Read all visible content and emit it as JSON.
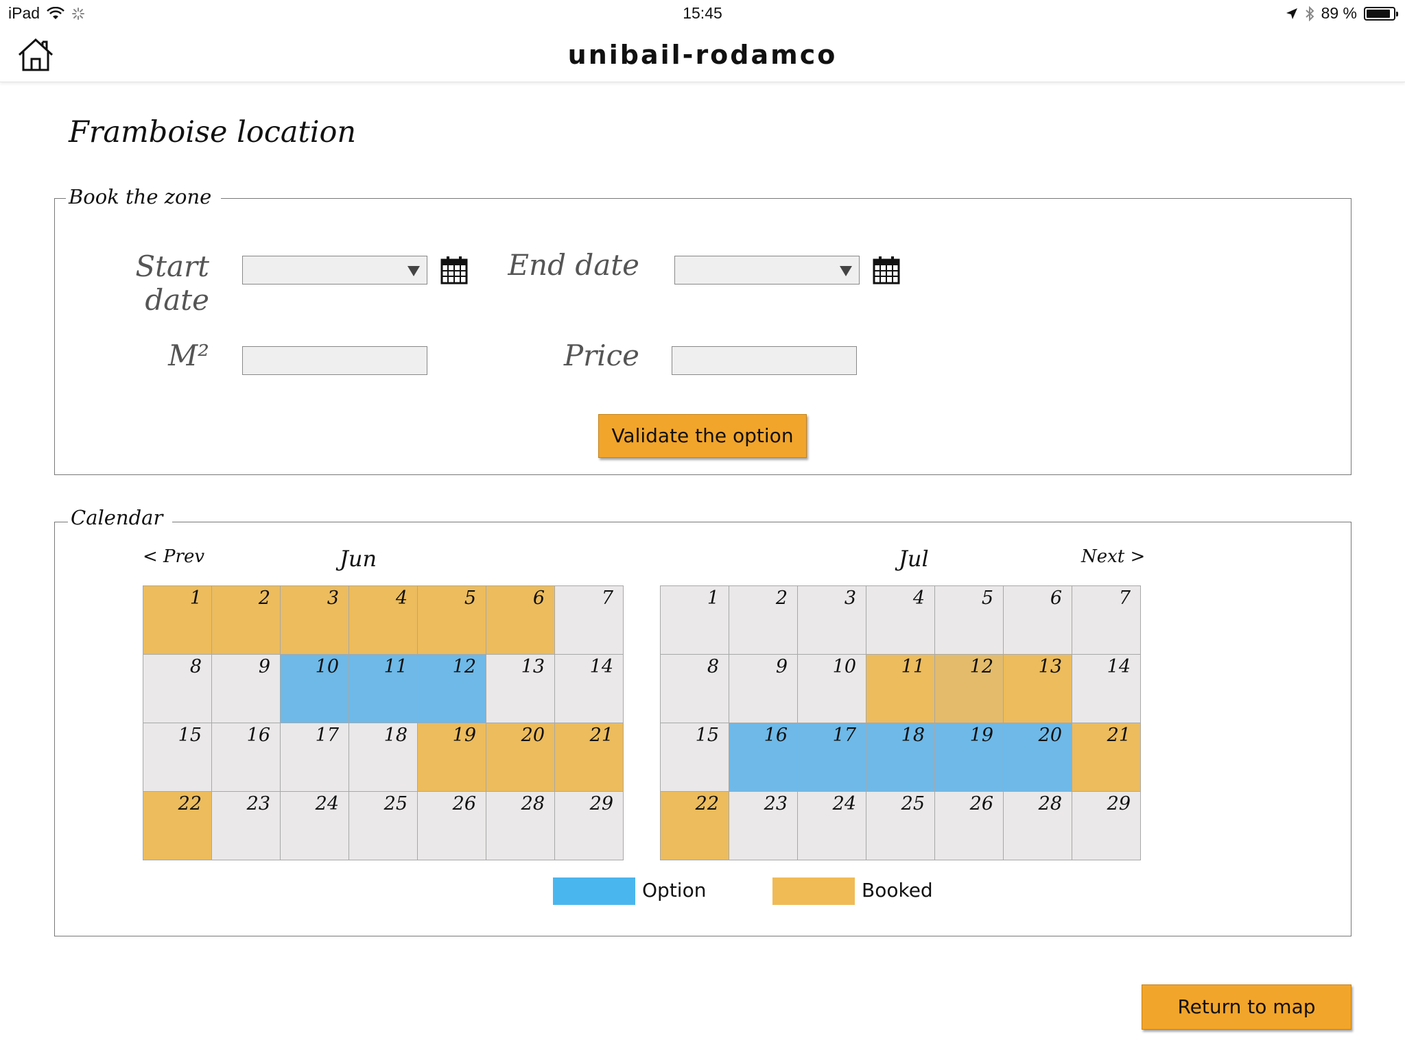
{
  "status_bar": {
    "device": "iPad",
    "time": "15:45",
    "battery": "89 %",
    "battery_level": 0.89
  },
  "nav": {
    "title": "unibail-rodamco",
    "home_icon": "home-icon"
  },
  "page": {
    "title": "Framboise location"
  },
  "booking": {
    "legend": "Book the zone",
    "start_label": "Start date",
    "end_label": "End date",
    "m2_label": "M²",
    "price_label": "Price",
    "start_value": "",
    "end_value": "",
    "m2_value": "",
    "price_value": "",
    "validate_label": "Validate the option"
  },
  "calendar": {
    "legend": "Calendar",
    "prev_label": "< Prev",
    "next_label": "Next >",
    "months": [
      {
        "name": "Jun",
        "days": [
          {
            "d": "1",
            "s": "booked"
          },
          {
            "d": "2",
            "s": "booked"
          },
          {
            "d": "3",
            "s": "booked"
          },
          {
            "d": "4",
            "s": "booked"
          },
          {
            "d": "5",
            "s": "booked"
          },
          {
            "d": "6",
            "s": "booked"
          },
          {
            "d": "7",
            "s": "free"
          },
          {
            "d": "8",
            "s": "free"
          },
          {
            "d": "9",
            "s": "free"
          },
          {
            "d": "10",
            "s": "option"
          },
          {
            "d": "11",
            "s": "option"
          },
          {
            "d": "12",
            "s": "option"
          },
          {
            "d": "13",
            "s": "free"
          },
          {
            "d": "14",
            "s": "free"
          },
          {
            "d": "15",
            "s": "free"
          },
          {
            "d": "16",
            "s": "free"
          },
          {
            "d": "17",
            "s": "free"
          },
          {
            "d": "18",
            "s": "free"
          },
          {
            "d": "19",
            "s": "booked"
          },
          {
            "d": "20",
            "s": "booked"
          },
          {
            "d": "21",
            "s": "booked"
          },
          {
            "d": "22",
            "s": "booked"
          },
          {
            "d": "23",
            "s": "free"
          },
          {
            "d": "24",
            "s": "free"
          },
          {
            "d": "25",
            "s": "free"
          },
          {
            "d": "26",
            "s": "free"
          },
          {
            "d": "28",
            "s": "free"
          },
          {
            "d": "29",
            "s": "free"
          }
        ]
      },
      {
        "name": "Jul",
        "days": [
          {
            "d": "1",
            "s": "free"
          },
          {
            "d": "2",
            "s": "free"
          },
          {
            "d": "3",
            "s": "free"
          },
          {
            "d": "4",
            "s": "free"
          },
          {
            "d": "5",
            "s": "free"
          },
          {
            "d": "6",
            "s": "free"
          },
          {
            "d": "7",
            "s": "free"
          },
          {
            "d": "8",
            "s": "free"
          },
          {
            "d": "9",
            "s": "free"
          },
          {
            "d": "10",
            "s": "free"
          },
          {
            "d": "11",
            "s": "booked"
          },
          {
            "d": "12",
            "s": "booked-dark"
          },
          {
            "d": "13",
            "s": "booked"
          },
          {
            "d": "14",
            "s": "free"
          },
          {
            "d": "15",
            "s": "free"
          },
          {
            "d": "16",
            "s": "option"
          },
          {
            "d": "17",
            "s": "option"
          },
          {
            "d": "18",
            "s": "option"
          },
          {
            "d": "19",
            "s": "option"
          },
          {
            "d": "20",
            "s": "option"
          },
          {
            "d": "21",
            "s": "booked"
          },
          {
            "d": "22",
            "s": "booked"
          },
          {
            "d": "23",
            "s": "free"
          },
          {
            "d": "24",
            "s": "free"
          },
          {
            "d": "25",
            "s": "free"
          },
          {
            "d": "26",
            "s": "free"
          },
          {
            "d": "28",
            "s": "free"
          },
          {
            "d": "29",
            "s": "free"
          }
        ]
      }
    ],
    "legend_items": {
      "option": "Option",
      "booked": "Booked"
    },
    "colors": {
      "option": "#6eb9e8",
      "booked": "#ecbc5d",
      "free": "#eae8e8",
      "legend_option": "#4ab6ee",
      "legend_booked": "#f0bb55"
    }
  },
  "footer": {
    "return_label": "Return to map"
  },
  "colors": {
    "button": "#f2a52b"
  }
}
